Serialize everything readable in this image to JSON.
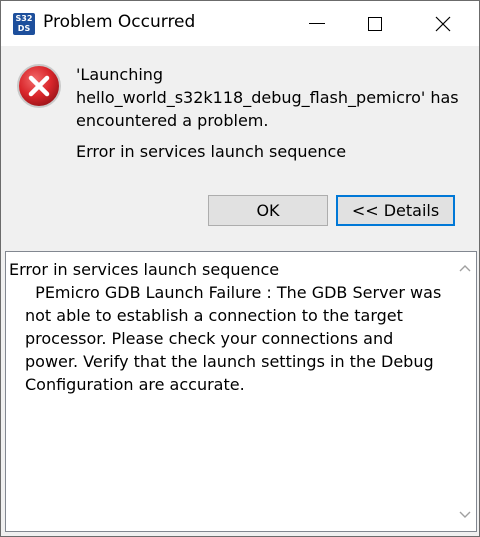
{
  "window": {
    "title": "Problem Occurred",
    "app_icon_text_top": "S32",
    "app_icon_text_bottom": "DS"
  },
  "message": {
    "line1": "'Launching",
    "line2": "hello_world_s32k118_debug_flash_pemicro' has",
    "line3": "encountered a problem.",
    "sub": "Error in services launch sequence"
  },
  "buttons": {
    "ok": "OK",
    "details": "<< Details"
  },
  "details": {
    "line1": "Error in services launch sequence",
    "line2": "  PEmicro GDB Launch Failure : The GDB Server was not able to establish a connection to the target processor. Please check your connections and power. Verify that the launch settings in the Debug Configuration are accurate."
  },
  "icons": {
    "error": "error-icon",
    "minimize": "minimize-icon",
    "maximize": "maximize-icon",
    "close": "close-icon"
  },
  "colors": {
    "error_red": "#d9262b",
    "focus_blue": "#0078d7"
  }
}
